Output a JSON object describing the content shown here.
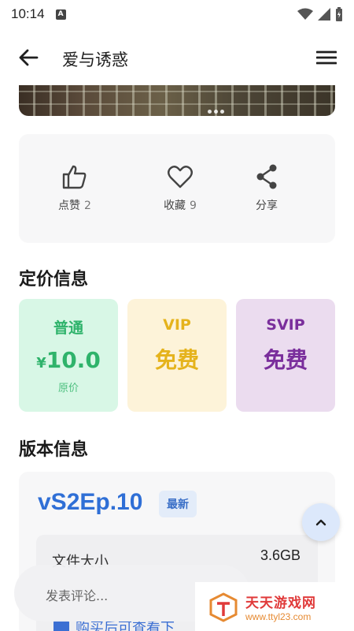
{
  "status_bar": {
    "time": "10:14",
    "notification_icon_letter": "A"
  },
  "app_bar": {
    "title": "爱与诱惑"
  },
  "actions": [
    {
      "icon": "thumb-up-icon",
      "label": "点赞",
      "count": "2"
    },
    {
      "icon": "heart-icon",
      "label": "收藏",
      "count": "9"
    },
    {
      "icon": "share-icon",
      "label": "分享"
    }
  ],
  "pricing": {
    "title": "定价信息",
    "tiers": [
      {
        "name": "普通",
        "currency": "¥",
        "price": "10.0",
        "note": "原价",
        "color": "#2fb36b",
        "bg": "#d8f7e6"
      },
      {
        "name": "VIP",
        "price": "免费",
        "color": "#e5b31c",
        "bg": "#fdf3d9"
      },
      {
        "name": "SVIP",
        "price": "免费",
        "color": "#7a2e9c",
        "bg": "#ebdcef"
      }
    ]
  },
  "version": {
    "title": "版本信息",
    "name": "vS2Ep.10",
    "badge": "最新",
    "file_size_label": "文件大小",
    "file_size": "3.6GB"
  },
  "comment": {
    "placeholder": "发表评论..."
  },
  "purchase_hint": "购买后可查看下",
  "watermark": {
    "brand": "天天游戏网",
    "url": "www.ttyl23.com"
  },
  "colors": {
    "accent_blue": "#2f6fd6",
    "card_bg": "#f7f7f8"
  }
}
